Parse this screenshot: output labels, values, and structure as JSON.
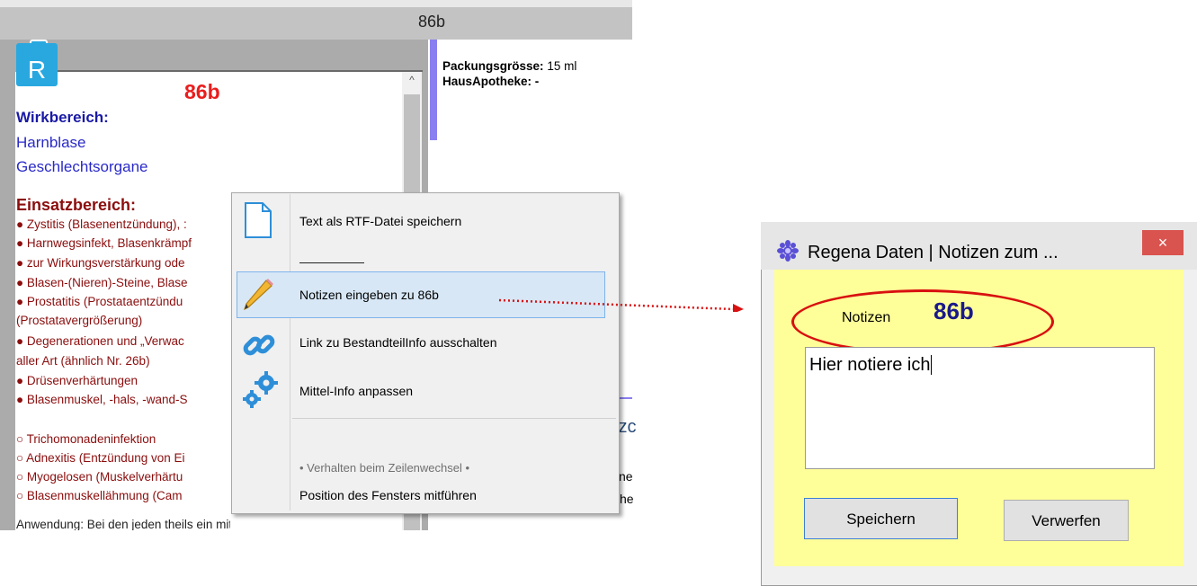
{
  "window": {
    "title": "86b"
  },
  "left": {
    "drug_title": "86b",
    "wirkbereich_head": "Wirkbereich:",
    "wirkbereich_items": [
      "Harnblase",
      "Geschlechtsorgane"
    ],
    "einsatz_head": "Einsatzbereich:",
    "einsatz_lines": [
      "● Zystitis (Blasenentzündung), :",
      "● Harnwegsinfekt, Blasenkrämpf",
      "● zur Wirkungsverstärkung ode",
      "● Blasen-(Nieren)-Steine, Blase",
      "● Prostatitis (Prostataentzündu",
      "(Prostatavergrößerung)",
      "● Degenerationen und „Verwac",
      "aller Art (ähnlich Nr. 26b)",
      "● Drüsenverhärtungen",
      "● Blasenmuskel, -hals, -wand-S"
    ],
    "secondary_lines": [
      "○ Trichomonadeninfektion",
      "○ Adnexitis (Entzündung von Ei",
      "○ Myogelosen (Muskelverhärtu",
      "○ Blasenmuskellähmung (Cam"
    ],
    "cut_line": "Anwendung: Bei den jeden theils ein mittel"
  },
  "right": {
    "packungsgroesse_label": "Packungsgrösse:",
    "packungsgroesse_value": "15 ml",
    "hausapotheke_label": "HausApotheke:",
    "hausapotheke_value": "-",
    "partial_text_1": "tzc",
    "partial_text_2": "ne",
    "partial_text_3": "che"
  },
  "context_menu": {
    "items": [
      {
        "label": "Text als RTF-Datei speichern",
        "icon": "document-icon"
      },
      {
        "label": "Notizen eingeben zu 86b",
        "icon": "pencil-icon"
      },
      {
        "label": "Link zu BestandteilInfo ausschalten",
        "icon": "link-icon"
      },
      {
        "label": "Mittel-Info anpassen",
        "icon": "gears-icon"
      }
    ],
    "section_label": "• Verhalten beim Zeilenwechsel •",
    "last_item": "Position des Fensters mitführen"
  },
  "dialog": {
    "title": "Regena Daten | Notizen zum ...",
    "close_label": "×",
    "notizen_label": "Notizen",
    "notizen_value": "86b",
    "notes_text": "Hier notiere ich",
    "save_label": "Speichern",
    "discard_label": "Verwerfen"
  },
  "colors": {
    "accent_red": "#ea1d1d",
    "dialog_bg": "#ffff99",
    "menu_highlight": "#d7e7f6"
  }
}
